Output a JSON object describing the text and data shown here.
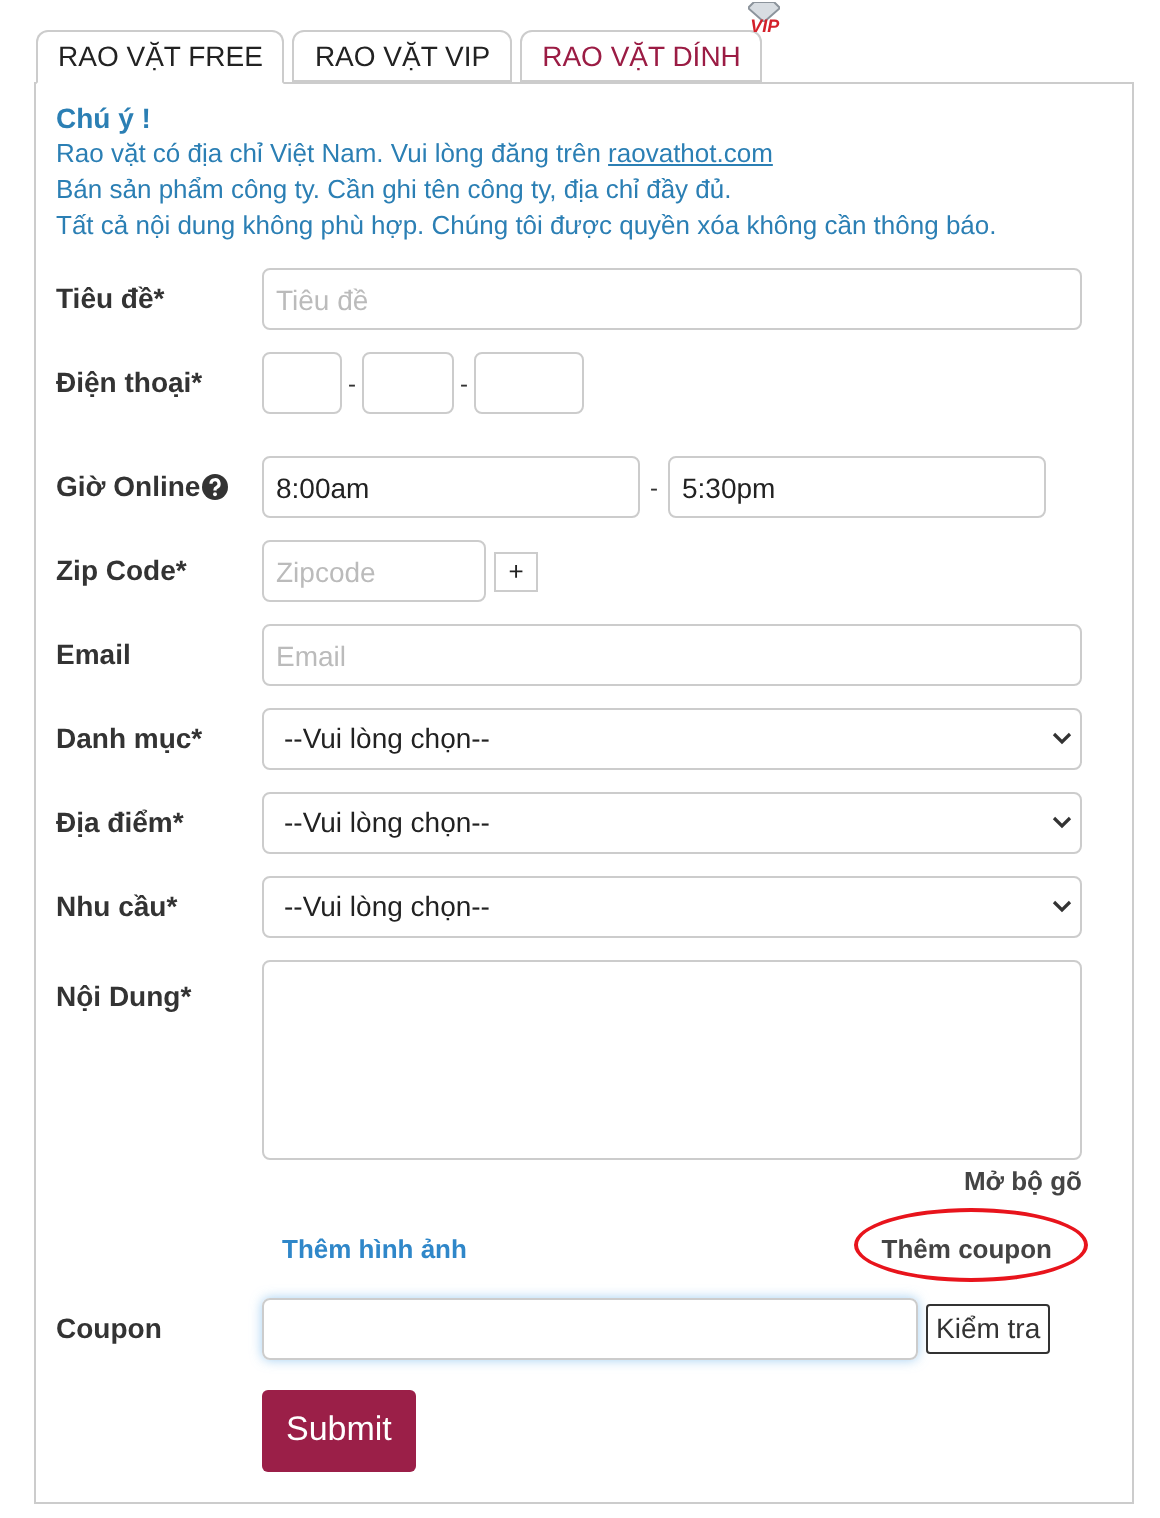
{
  "tabs": [
    {
      "label": "RAO VẶT FREE",
      "selected": true,
      "color": "#222222"
    },
    {
      "label": "RAO VẶT VIP",
      "selected": false,
      "color": "#222222"
    },
    {
      "label": "RAO VẶT DÍNH",
      "selected": false,
      "color": "#9b1c44",
      "badge": "VIP"
    }
  ],
  "notice": {
    "title": "Chú ý !",
    "lines": [
      {
        "text": "Rao vặt có địa chỉ Việt Nam. Vui lòng đăng trên",
        "link": "raovathot.com"
      },
      {
        "text": "Bán sản phẩm công ty. Cần ghi tên công ty, địa chỉ đầy đủ."
      },
      {
        "text": "Tất cả nội dung không phù hợp. Chúng tôi được quyền xóa không cần thông báo."
      }
    ]
  },
  "fields": [
    {
      "kind": "text",
      "label": "Tiêu đề*",
      "placeholder": "Tiêu đề"
    },
    {
      "kind": "phone",
      "label": "Điện thoại*",
      "separators": [
        "-",
        "-"
      ]
    },
    {
      "kind": "time-range",
      "label": "Giờ Online",
      "help": true,
      "from": "8:00am",
      "separator": "-",
      "to": "5:30pm"
    },
    {
      "kind": "zip",
      "label": "Zip Code*",
      "placeholder": "Zipcode",
      "button": "+"
    },
    {
      "kind": "text",
      "label": "Email",
      "placeholder": "Email"
    },
    {
      "kind": "select",
      "label": "Danh mục*",
      "value": "--Vui lòng chọn--"
    },
    {
      "kind": "select",
      "label": "Địa điểm*",
      "value": "--Vui lòng chọn--"
    },
    {
      "kind": "select",
      "label": "Nhu cầu*",
      "value": "--Vui lòng chọn--"
    },
    {
      "kind": "textarea",
      "label": "Nội Dung*",
      "link": "Mở bộ gõ"
    }
  ],
  "links": {
    "images": "Thêm hình ảnh",
    "coupon": "Thêm coupon",
    "coupon_highlighted": true
  },
  "coupon": {
    "label": "Coupon",
    "focused": true,
    "button": "Kiểm tra"
  },
  "submit": "Submit"
}
